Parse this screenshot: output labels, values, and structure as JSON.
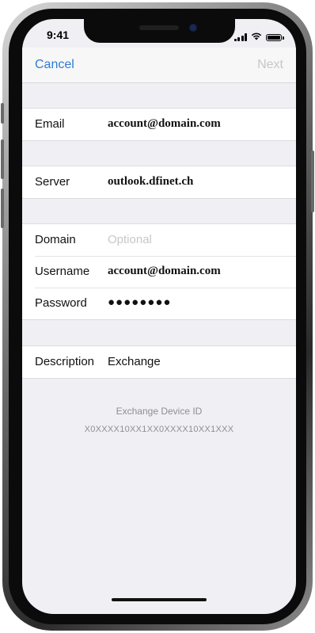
{
  "status_bar": {
    "time": "9:41"
  },
  "nav": {
    "cancel_label": "Cancel",
    "next_label": "Next"
  },
  "sections": {
    "email": {
      "label": "Email",
      "value": "account@domain.com"
    },
    "server": {
      "label": "Server",
      "value": "outlook.dfinet.ch"
    },
    "domain": {
      "label": "Domain",
      "placeholder": "Optional"
    },
    "username": {
      "label": "Username",
      "value": "account@domain.com"
    },
    "password": {
      "label": "Password",
      "value": "●●●●●●●●"
    },
    "description": {
      "label": "Description",
      "value": "Exchange"
    }
  },
  "device": {
    "label": "Exchange Device ID",
    "value": "X0XXXX10XX1XX0XXXX10XX1XXX"
  },
  "colors": {
    "accent": "#2f7bd8",
    "disabled": "#c7c7cc",
    "background": "#efeff4"
  },
  "icons": [
    "signal-icon",
    "wifi-icon",
    "battery-icon"
  ]
}
